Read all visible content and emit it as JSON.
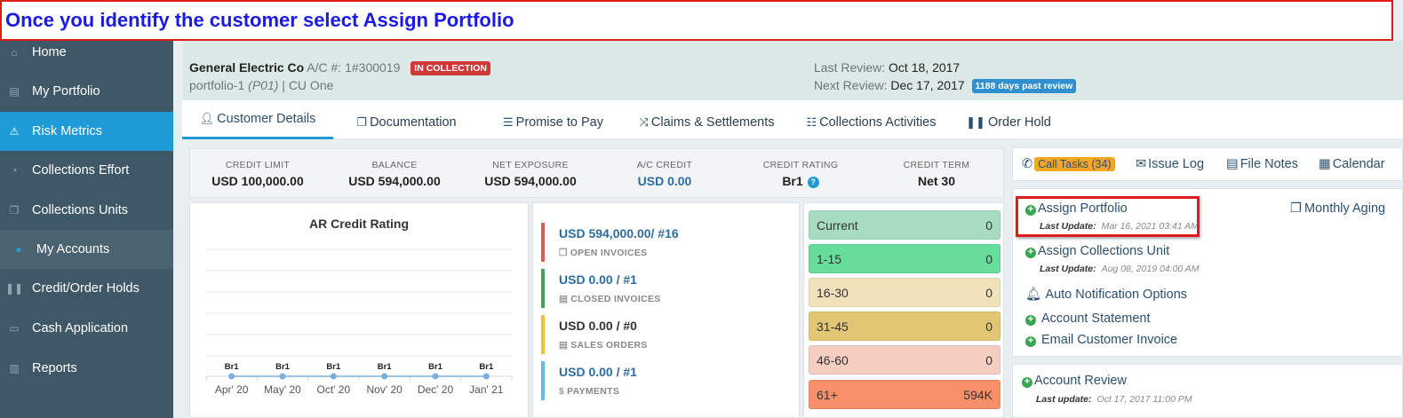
{
  "banner": {
    "text": "Once you identify the customer select Assign Portfolio"
  },
  "sidebar": {
    "items": [
      {
        "label": "Home",
        "icon": "home-icon"
      },
      {
        "label": "My Portfolio",
        "icon": "portfolio-icon"
      },
      {
        "label": "Risk Metrics",
        "icon": "warning-icon",
        "active": true
      },
      {
        "label": "Collections Effort",
        "icon": "effort-icon"
      },
      {
        "label": "Collections Units",
        "icon": "units-icon"
      },
      {
        "label": "My Accounts",
        "icon": "user-circle-icon",
        "sub": true
      },
      {
        "label": "Credit/Order Holds",
        "icon": "pause-icon"
      },
      {
        "label": "Cash Application",
        "icon": "cash-icon"
      },
      {
        "label": "Reports",
        "icon": "chart-icon"
      }
    ]
  },
  "header": {
    "customer_name": "General Electric Co",
    "account_label": "A/C #:",
    "account_number": "1#300019",
    "status_badge": "IN COLLECTION",
    "portfolio": "portfolio-1",
    "portfolio_code": "(P01)",
    "separator": "|",
    "unit": "CU One",
    "last_review_label": "Last Review:",
    "last_review_date": "Oct 18, 2017",
    "next_review_label": "Next Review:",
    "next_review_date": "Dec 17, 2017",
    "past_review_badge": "1188 days past review"
  },
  "tabs": [
    {
      "label": "Customer Details",
      "icon": "user-icon",
      "active": true
    },
    {
      "label": "Documentation",
      "icon": "documents-icon"
    },
    {
      "label": "Promise to Pay",
      "icon": "list-icon"
    },
    {
      "label": "Claims & Settlements",
      "icon": "shuffle-icon"
    },
    {
      "label": "Collections Activities",
      "icon": "tasks-icon"
    },
    {
      "label": "Order Hold",
      "icon": "pause-icon"
    }
  ],
  "metrics": [
    {
      "label": "CREDIT LIMIT",
      "value": "USD 100,000.00"
    },
    {
      "label": "BALANCE",
      "value": "USD 594,000.00"
    },
    {
      "label": "NET EXPOSURE",
      "value": "USD 594,000.00"
    },
    {
      "label": "A/C CREDIT",
      "value": "USD 0.00"
    },
    {
      "label": "CREDIT RATING",
      "value": "Br1"
    },
    {
      "label": "CREDIT TERM",
      "value": "Net 30"
    }
  ],
  "chart_data": {
    "type": "line",
    "title": "AR Credit Rating",
    "categories": [
      "Apr' 20",
      "May' 20",
      "Oct' 20",
      "Nov' 20",
      "Dec' 20",
      "Jan' 21"
    ],
    "point_labels": [
      "Br1",
      "Br1",
      "Br1",
      "Br1",
      "Br1",
      "Br1"
    ],
    "series": [
      {
        "color": "#7aaee0",
        "values": [
          0,
          0,
          0,
          0,
          0,
          0
        ]
      }
    ],
    "grid": true
  },
  "invoices": [
    {
      "value": "USD 594,000.00/ #16",
      "label": "OPEN INVOICES",
      "icon": "copy-icon",
      "color": "#e05a5a"
    },
    {
      "value": "USD 0.00 / #1",
      "label": "CLOSED INVOICES",
      "icon": "file-icon",
      "color": "#3aa655"
    },
    {
      "value": "USD 0.00 / #0",
      "label": "SALES ORDERS",
      "icon": "file-icon",
      "color": "#f2c12e"
    },
    {
      "value": "USD 0.00 / #1",
      "label": "PAYMENTS",
      "icon": "dollar-icon",
      "color": "#5bc0de"
    }
  ],
  "aging": [
    {
      "label": "Current",
      "value": "0",
      "color": "#a7dcc1"
    },
    {
      "label": "1-15",
      "value": "0",
      "color": "#68dc9b"
    },
    {
      "label": "16-30",
      "value": "0",
      "color": "#f1e2bb"
    },
    {
      "label": "31-45",
      "value": "0",
      "color": "#e3c674"
    },
    {
      "label": "46-60",
      "value": "0",
      "color": "#f6cdc1"
    },
    {
      "label": "61+",
      "value": "594K",
      "color": "#f78f6b"
    }
  ],
  "right_tabs": {
    "call_tasks": "Call Tasks (34)",
    "issue_log": "Issue Log",
    "file_notes": "File Notes",
    "calendar": "Calendar"
  },
  "actions": {
    "assign_portfolio": "Assign Portfolio",
    "assign_portfolio_update_label": "Last Update:",
    "assign_portfolio_update": "Mar 16, 2021 03:41 AM",
    "monthly_aging": "Monthly Aging",
    "assign_unit": "Assign Collections Unit",
    "assign_unit_update_label": "Last Update:",
    "assign_unit_update": "Aug 08, 2019 04:00 AM",
    "auto_notification": "Auto Notification Options",
    "account_statement": "Account Statement",
    "email_invoice": "Email Customer Invoice"
  },
  "review_card": {
    "title": "Account Review",
    "update_label": "Last update:",
    "update": "Oct 17, 2017 11:00 PM"
  }
}
